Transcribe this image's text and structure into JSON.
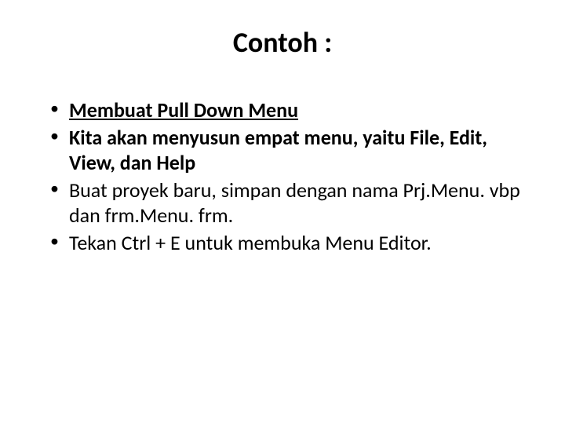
{
  "title": "Contoh :",
  "bullets": {
    "item1": "Membuat Pull Down Menu",
    "item2": " Kita akan menyusun empat menu, yaitu File, Edit, View, dan Help",
    "item3": "Buat proyek baru, simpan dengan nama Prj.Menu. vbp dan frm.Menu. frm.",
    "item4": "Tekan Ctrl + E untuk membuka Menu Editor."
  }
}
